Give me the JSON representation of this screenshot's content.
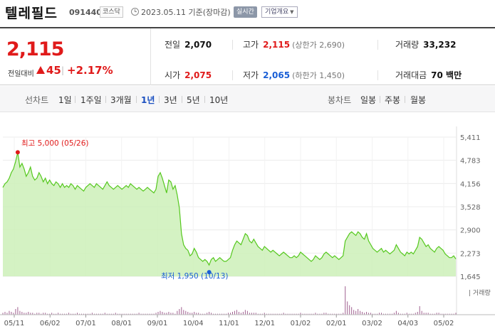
{
  "stock": {
    "name": "텔레필드",
    "code": "091440",
    "market": "코스닥",
    "as_of": "2023.05.11 기준(장마감)",
    "realtime_label": "실시간",
    "overview_label": "기업개요"
  },
  "quote": {
    "price": "2,115",
    "change_label": "전일대비",
    "change_amount": "45",
    "change_pct": "+2.17%"
  },
  "stats": {
    "prev_close": {
      "label": "전일",
      "value": "2,070"
    },
    "high": {
      "label": "고가",
      "value": "2,115",
      "sub": "(상한가 2,690)"
    },
    "volume": {
      "label": "거래량",
      "value": "33,232"
    },
    "open": {
      "label": "시가",
      "value": "2,075"
    },
    "low": {
      "label": "저가",
      "value": "2,065",
      "sub": "(하한가 1,450)"
    },
    "amount": {
      "label": "거래대금",
      "value": "70 백만"
    }
  },
  "tabs": {
    "line_label": "선차트",
    "line_periods": [
      "1일",
      "1주일",
      "3개월",
      "1년",
      "3년",
      "5년",
      "10년"
    ],
    "active_period": "1년",
    "candle_label": "봉차트",
    "candle_periods": [
      "일봉",
      "주봉",
      "월봉"
    ]
  },
  "colors": {
    "up": "#e01a1a",
    "down": "#1a5fd6",
    "line": "#55c81e",
    "area": "#cdf0b8",
    "volume": "#a06090"
  },
  "chart_data": {
    "type": "area",
    "title": "",
    "ylim": [
      1645,
      5411
    ],
    "y_ticks": [
      "5,411",
      "4,783",
      "4,156",
      "3,528",
      "2,900",
      "2,273",
      "1,645"
    ],
    "x_ticks": [
      "05/11",
      "06/02",
      "07/01",
      "08/01",
      "09/01",
      "10/04",
      "11/01",
      "12/01",
      "01/02",
      "02/01",
      "03/02",
      "04/03",
      "05/02"
    ],
    "high_annotation": "최고 5,000 (05/26)",
    "low_annotation": "최저 1,950 (10/13)",
    "volume_label": "거래량",
    "price_series": [
      4050,
      4150,
      4200,
      4300,
      4450,
      4550,
      4750,
      5000,
      4600,
      4700,
      4550,
      4350,
      4450,
      4600,
      4350,
      4250,
      4300,
      4450,
      4350,
      4200,
      4300,
      4150,
      4250,
      4150,
      4100,
      4200,
      4150,
      4050,
      4150,
      4050,
      4100,
      4050,
      4150,
      4100,
      4000,
      4100,
      4050,
      4000,
      3950,
      4050,
      4100,
      4150,
      4100,
      4050,
      4150,
      4100,
      4050,
      4000,
      4100,
      4200,
      4100,
      4050,
      4000,
      4050,
      4100,
      4050,
      4000,
      4050,
      4100,
      4050,
      4150,
      4100,
      4050,
      4000,
      4050,
      4000,
      3950,
      4000,
      4050,
      4000,
      3950,
      3900,
      4000,
      4350,
      4450,
      4300,
      4100,
      3900,
      4250,
      4200,
      4000,
      4100,
      3850,
      3500,
      2800,
      2500,
      2400,
      2350,
      2200,
      2250,
      2400,
      2300,
      2150,
      2100,
      2050,
      2100,
      2050,
      1950,
      2100,
      2150,
      2050,
      2100,
      2150,
      2100,
      2050,
      2050,
      2100,
      2150,
      2350,
      2500,
      2600,
      2550,
      2500,
      2650,
      2800,
      2750,
      2600,
      2550,
      2650,
      2550,
      2450,
      2400,
      2350,
      2450,
      2400,
      2350,
      2300,
      2350,
      2300,
      2250,
      2200,
      2250,
      2300,
      2250,
      2200,
      2150,
      2150,
      2200,
      2150,
      2200,
      2300,
      2250,
      2200,
      2150,
      2100,
      2050,
      2100,
      2200,
      2150,
      2100,
      2150,
      2250,
      2300,
      2250,
      2200,
      2150,
      2200,
      2150,
      2100,
      2150,
      2200,
      2600,
      2700,
      2800,
      2850,
      2800,
      2750,
      2850,
      2800,
      2700,
      2650,
      2800,
      2600,
      2500,
      2400,
      2350,
      2300,
      2350,
      2400,
      2300,
      2350,
      2300,
      2250,
      2300,
      2350,
      2500,
      2400,
      2300,
      2250,
      2200,
      2300,
      2250,
      2300,
      2250,
      2350,
      2450,
      2700,
      2650,
      2550,
      2450,
      2500,
      2400,
      2350,
      2300,
      2400,
      2450,
      2400,
      2350,
      2250,
      2200,
      2150,
      2150,
      2200,
      2115
    ],
    "volume_series": [
      2,
      3,
      2,
      4,
      3,
      2,
      6,
      8,
      4,
      3,
      2,
      2,
      3,
      2,
      2,
      1,
      2,
      2,
      1,
      2,
      2,
      1,
      1,
      2,
      1,
      1,
      2,
      1,
      1,
      1,
      1,
      2,
      1,
      1,
      1,
      2,
      1,
      1,
      1,
      1,
      1,
      1,
      2,
      1,
      1,
      1,
      1,
      1,
      2,
      1,
      1,
      1,
      1,
      2,
      1,
      1,
      1,
      1,
      1,
      1,
      1,
      1,
      1,
      1,
      2,
      1,
      1,
      1,
      1,
      1,
      1,
      1,
      2,
      3,
      4,
      3,
      2,
      2,
      3,
      2,
      2,
      1,
      4,
      6,
      8,
      5,
      4,
      3,
      2,
      2,
      3,
      2,
      2,
      1,
      1,
      1,
      2,
      3,
      2,
      1,
      1,
      1,
      1,
      1,
      1,
      1,
      2,
      2,
      3,
      4,
      5,
      3,
      2,
      3,
      5,
      4,
      2,
      2,
      2,
      2,
      1,
      1,
      1,
      2,
      1,
      1,
      1,
      1,
      1,
      1,
      1,
      1,
      2,
      1,
      1,
      1,
      1,
      1,
      1,
      1,
      2,
      1,
      1,
      1,
      1,
      1,
      1,
      2,
      1,
      1,
      1,
      2,
      2,
      1,
      1,
      1,
      1,
      1,
      1,
      1,
      2,
      30,
      14,
      10,
      8,
      5,
      4,
      6,
      4,
      3,
      2,
      3,
      2,
      2,
      1,
      1,
      1,
      2,
      2,
      1,
      1,
      1,
      1,
      1,
      2,
      4,
      2,
      1,
      1,
      1,
      2,
      1,
      1,
      1,
      2,
      3,
      9,
      4,
      2,
      2,
      2,
      1,
      1,
      1,
      2,
      2,
      1,
      1,
      1,
      1,
      1,
      1,
      1,
      2
    ]
  }
}
